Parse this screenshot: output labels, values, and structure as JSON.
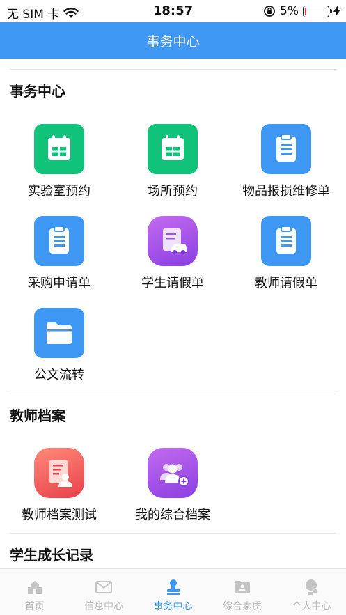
{
  "status_bar": {
    "carrier": "无 SIM 卡",
    "time": "18:57",
    "battery_percent": "5%",
    "battery_level": 0.05
  },
  "nav": {
    "title": "事务中心"
  },
  "sections": [
    {
      "title": "事务中心",
      "items": [
        {
          "label": "实验室预约",
          "icon": "calendar-icon",
          "color": "#10c27a"
        },
        {
          "label": "场所预约",
          "icon": "calendar-icon",
          "color": "#10c27a"
        },
        {
          "label": "物品报损维修单",
          "icon": "clipboard-icon",
          "color": "#3d97f3"
        },
        {
          "label": "采购申请单",
          "icon": "clipboard-icon",
          "color": "#3d97f3"
        },
        {
          "label": "学生请假单",
          "icon": "leave-form-icon",
          "color": "#a452ea"
        },
        {
          "label": "教师请假单",
          "icon": "clipboard-icon",
          "color": "#3d97f3"
        },
        {
          "label": "公文流转",
          "icon": "folder-icon",
          "color": "#3d97f3"
        }
      ]
    },
    {
      "title": "教师档案",
      "items": [
        {
          "label": "教师档案测试",
          "icon": "profile-document-icon",
          "color": "#ef5a5a"
        },
        {
          "label": "我的综合档案",
          "icon": "group-add-icon",
          "color": "#a452ea"
        }
      ]
    },
    {
      "title": "学生成长记录",
      "items": []
    }
  ],
  "tabs": [
    {
      "label": "首页",
      "icon": "home-icon",
      "active": false
    },
    {
      "label": "信息中心",
      "icon": "mail-icon",
      "active": false
    },
    {
      "label": "事务中心",
      "icon": "stamp-icon",
      "active": true
    },
    {
      "label": "综合素质",
      "icon": "folder-user-icon",
      "active": false
    },
    {
      "label": "个人中心",
      "icon": "person-icon",
      "active": false
    }
  ]
}
